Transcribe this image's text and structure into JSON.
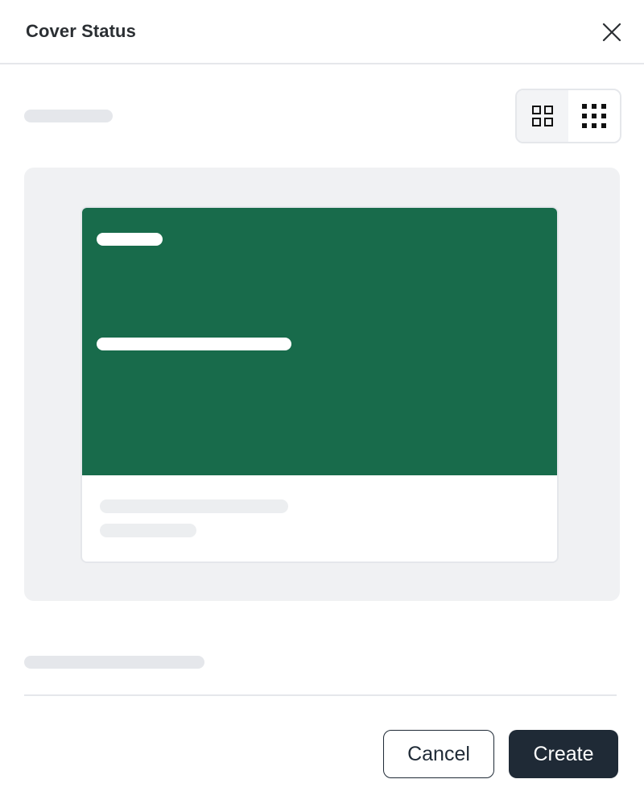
{
  "dialog": {
    "title": "Cover Status",
    "close_icon": "close-icon"
  },
  "view_toggle": {
    "options": [
      {
        "icon": "grid-2x2-icon",
        "selected": true
      },
      {
        "icon": "grid-3x3-icon",
        "selected": false
      }
    ]
  },
  "preview": {
    "cover_color": "#186b4b"
  },
  "footer": {
    "cancel_label": "Cancel",
    "create_label": "Create"
  },
  "colors": {
    "primary_button": "#1f2a36",
    "skeleton": "#e5e7eb",
    "preview_background": "#f0f1f3"
  }
}
